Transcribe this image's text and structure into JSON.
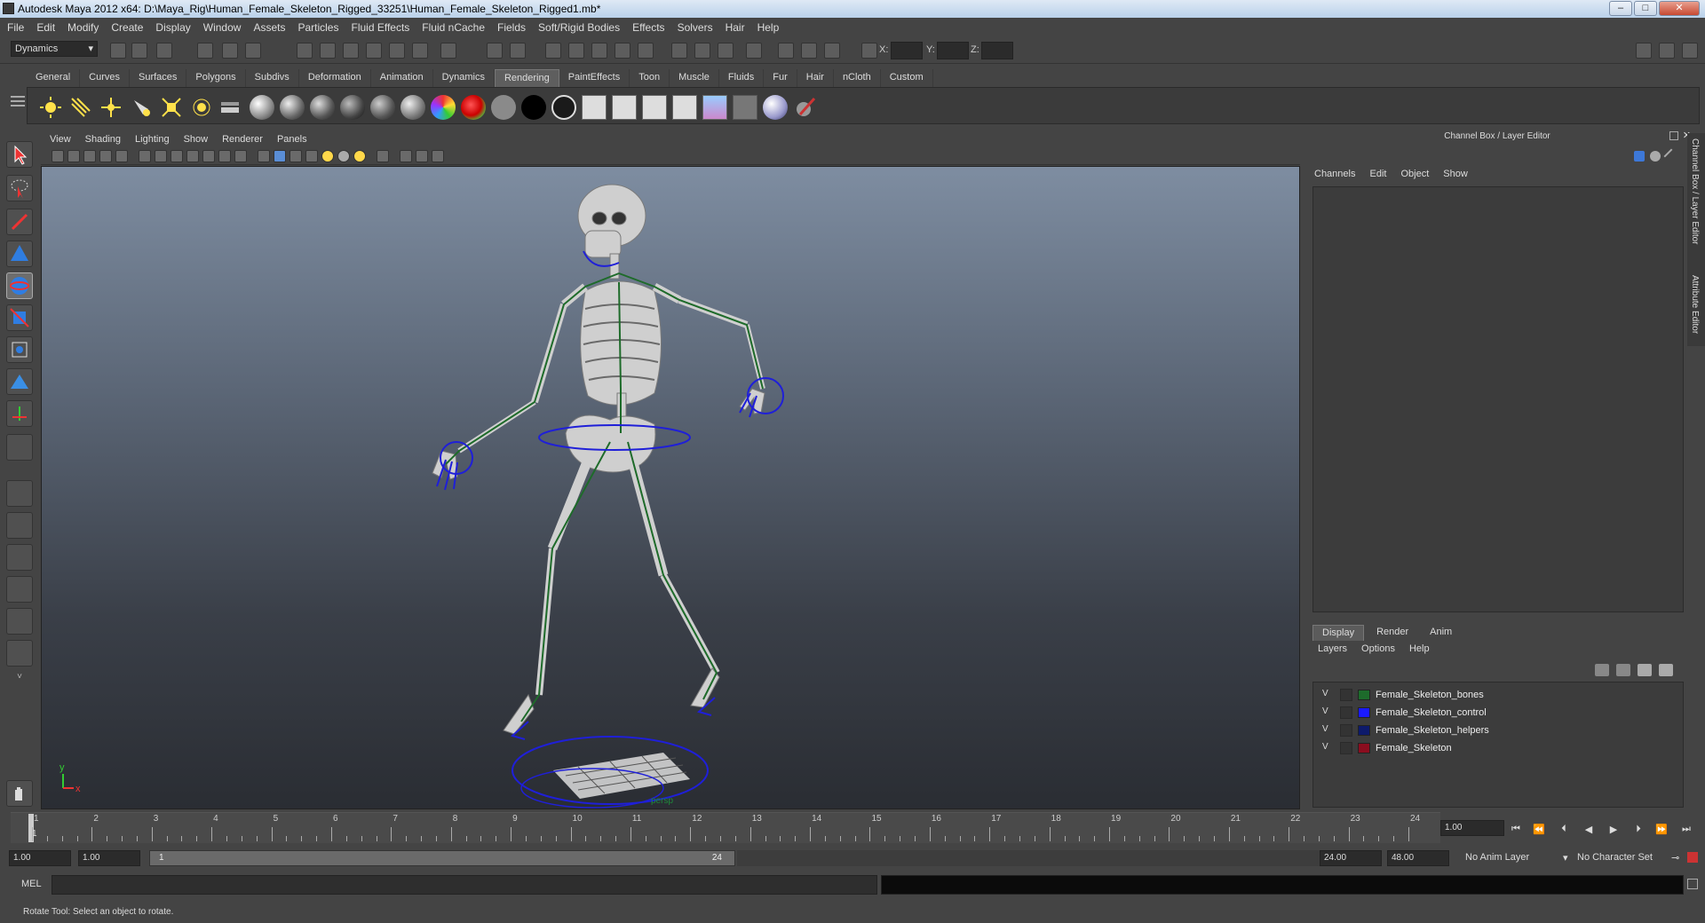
{
  "window": {
    "title": "Autodesk Maya 2012 x64: D:\\Maya_Rig\\Human_Female_Skeleton_Rigged_33251\\Human_Female_Skeleton_Rigged1.mb*",
    "minimize": "–",
    "maximize": "□",
    "close": "✕"
  },
  "menubar": [
    "File",
    "Edit",
    "Modify",
    "Create",
    "Display",
    "Window",
    "Assets",
    "Particles",
    "Fluid Effects",
    "Fluid nCache",
    "Fields",
    "Soft/Rigid Bodies",
    "Effects",
    "Solvers",
    "Hair",
    "Help"
  ],
  "statusline": {
    "mode": "Dynamics",
    "x_label": "X:",
    "y_label": "Y:",
    "z_label": "Z:"
  },
  "shelf": {
    "tabs": [
      "General",
      "Curves",
      "Surfaces",
      "Polygons",
      "Subdivs",
      "Deformation",
      "Animation",
      "Dynamics",
      "Rendering",
      "PaintEffects",
      "Toon",
      "Muscle",
      "Fluids",
      "Fur",
      "Hair",
      "nCloth",
      "Custom"
    ],
    "active_tab": "Rendering"
  },
  "viewport": {
    "menu": [
      "View",
      "Shading",
      "Lighting",
      "Show",
      "Renderer",
      "Panels"
    ],
    "camera_label": "persp",
    "axis_x": "x",
    "axis_y": "y"
  },
  "channel_box": {
    "header": "Channel Box / Layer Editor",
    "menu": [
      "Channels",
      "Edit",
      "Object",
      "Show"
    ],
    "side_tab_1": "Channel Box / Layer Editor",
    "side_tab_2": "Attribute Editor"
  },
  "layer_editor": {
    "tabs": [
      "Display",
      "Render",
      "Anim"
    ],
    "active_tab": "Display",
    "menu": [
      "Layers",
      "Options",
      "Help"
    ],
    "layers": [
      {
        "visible": "V",
        "name": "Female_Skeleton_bones",
        "color": "#1d6b2b"
      },
      {
        "visible": "V",
        "name": "Female_Skeleton_control",
        "color": "#1a1aff"
      },
      {
        "visible": "V",
        "name": "Female_Skeleton_helpers",
        "color": "#0d1a6b"
      },
      {
        "visible": "V",
        "name": "Female_Skeleton",
        "color": "#8b0d1f"
      }
    ]
  },
  "timeline": {
    "ticks": [
      "1",
      "2",
      "3",
      "4",
      "5",
      "6",
      "7",
      "8",
      "9",
      "10",
      "11",
      "12",
      "13",
      "14",
      "15",
      "16",
      "17",
      "18",
      "19",
      "20",
      "21",
      "22",
      "23",
      "24"
    ],
    "current_frame_marker": "1",
    "current_time": "1.00"
  },
  "range": {
    "start_time": "1.00",
    "playback_start": "1.00",
    "slider_start": "1",
    "slider_end": "24",
    "playback_end": "24.00",
    "end_time": "48.00",
    "anim_layer": "No Anim Layer",
    "character_set": "No Character Set"
  },
  "command_line": {
    "label": "MEL"
  },
  "help_line": {
    "text": "Rotate Tool: Select an object to rotate."
  }
}
